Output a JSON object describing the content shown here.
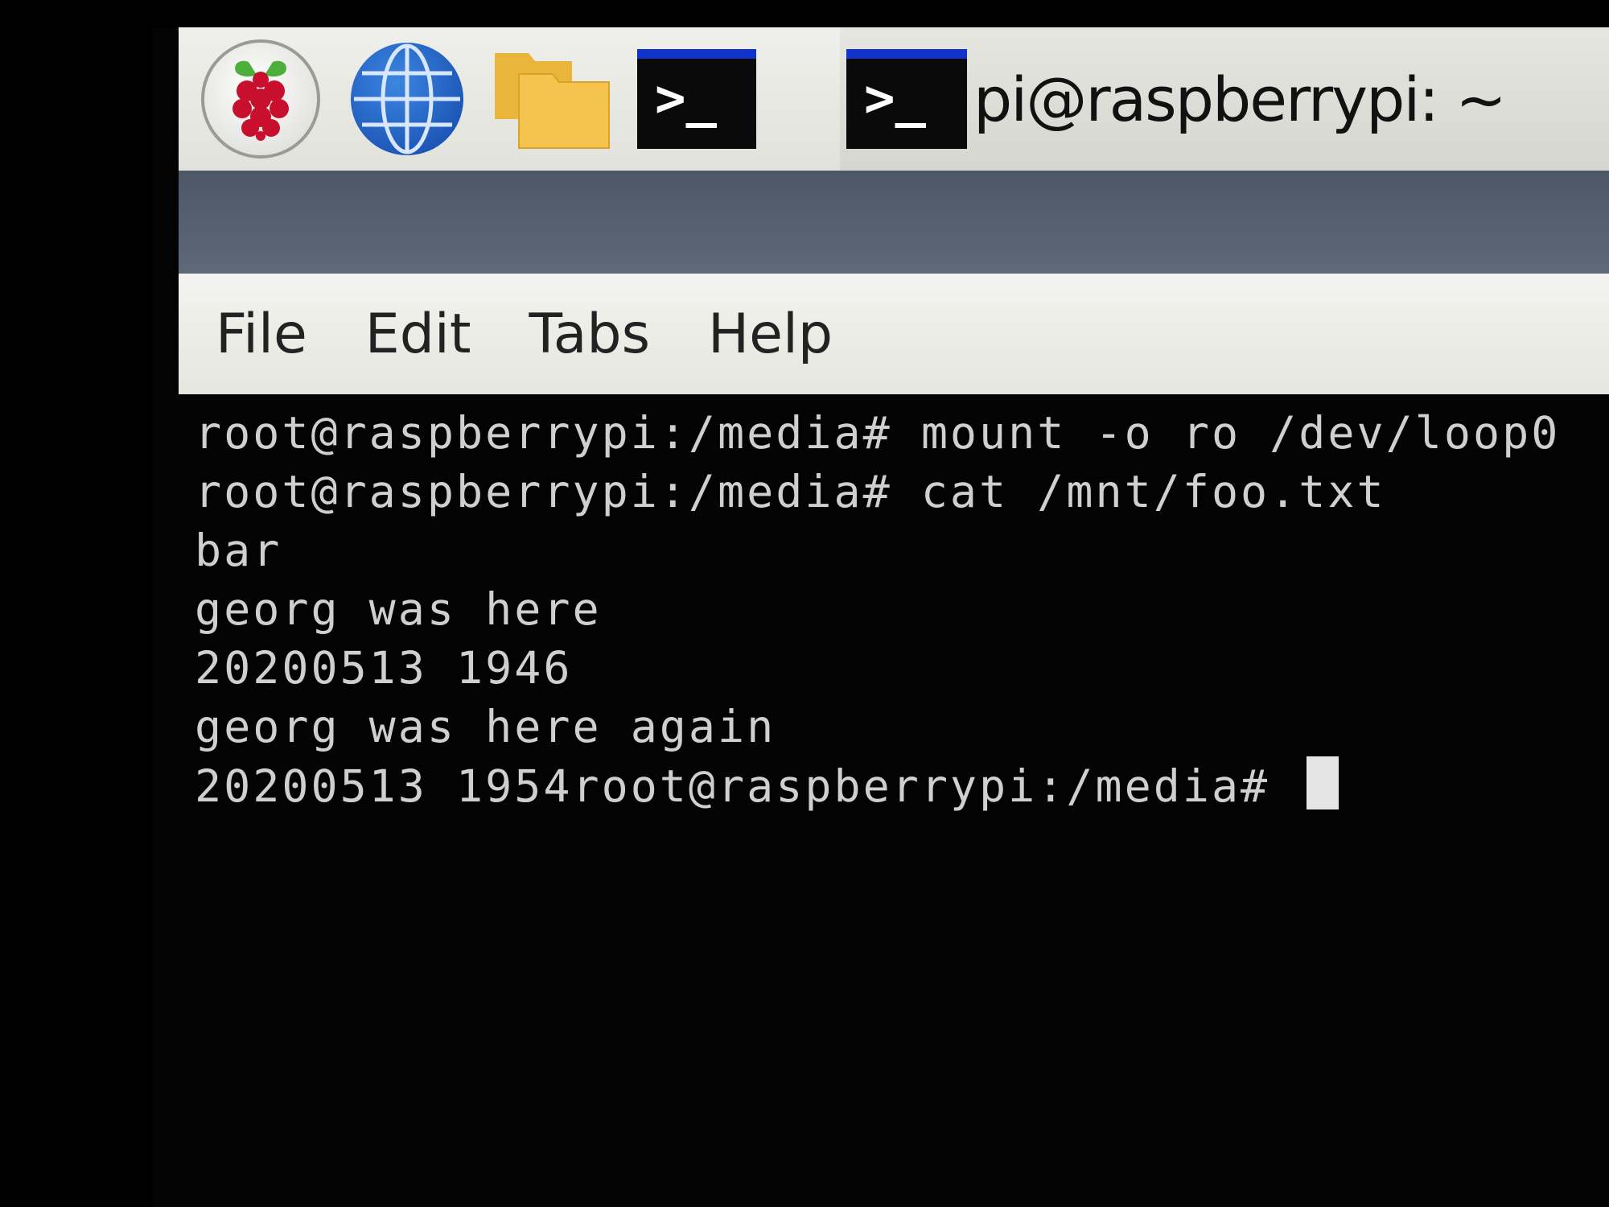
{
  "taskbar": {
    "launchers": [
      {
        "icon": "raspberry-pi-menu-icon"
      },
      {
        "icon": "web-browser-globe-icon"
      },
      {
        "icon": "file-manager-folder-icon"
      },
      {
        "icon": "terminal-icon",
        "glyph": ">_"
      }
    ],
    "window_button": {
      "icon": "terminal-icon",
      "glyph": ">_",
      "title": "pi@raspberrypi: ~"
    }
  },
  "menubar": {
    "items": [
      "File",
      "Edit",
      "Tabs",
      "Help"
    ]
  },
  "terminal": {
    "lines": [
      "root@raspberrypi:/media# mount -o ro /dev/loop0",
      "root@raspberrypi:/media# cat /mnt/foo.txt",
      "bar",
      "georg was here",
      "20200513 1946",
      "georg was here again",
      "20200513 1954root@raspberrypi:/media# "
    ]
  },
  "colors": {
    "taskbar_bg": "#e8e8e3",
    "titlebar_bg": "#56616f",
    "terminal_bg": "#030303",
    "terminal_fg": "#cfcfcf",
    "terminal_icon_stripe": "#1133cc"
  }
}
